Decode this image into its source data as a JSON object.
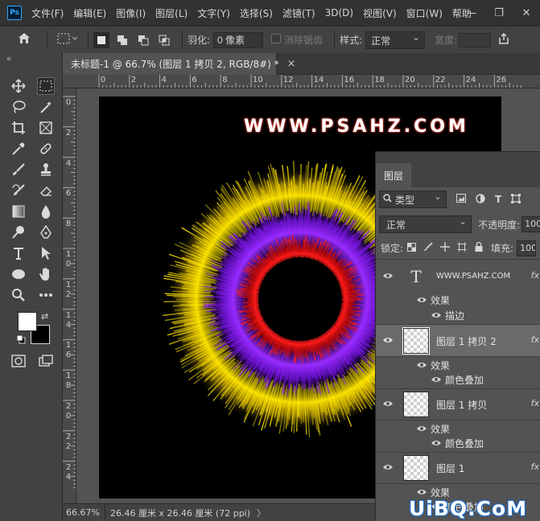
{
  "app": {
    "logo": "Ps"
  },
  "menu": [
    "文件(F)",
    "编辑(E)",
    "图像(I)",
    "图层(L)",
    "文字(Y)",
    "选择(S)",
    "滤镜(T)",
    "3D(D)",
    "视图(V)",
    "窗口(W)",
    "帮助"
  ],
  "window_controls": {
    "minimize": "—",
    "restore": "❐",
    "close": "✕"
  },
  "options_bar": {
    "feather_label": "羽化:",
    "feather_value": "0 像素",
    "antialias_label": "消除锯齿",
    "style_label": "样式:",
    "style_value": "正常",
    "width_label": "宽度:"
  },
  "toolbar": {
    "collapse": "«"
  },
  "document": {
    "tab_title": "未标题-1 @ 66.7% (图层 1 拷贝 2, RGB/8#) *",
    "close": "×",
    "watermark_text": "WWW.PSAHZ.COM"
  },
  "ruler": {
    "top_labels": [
      "0",
      "2",
      "4",
      "6",
      "8",
      "10",
      "12",
      "14",
      "16",
      "18",
      "20",
      "22",
      "24",
      "26"
    ],
    "left_labels": [
      "0",
      "2",
      "4",
      "6",
      "8",
      "10",
      "12",
      "14",
      "16",
      "18",
      "20",
      "22",
      "24"
    ]
  },
  "status_bar": {
    "zoom": "66.67%",
    "doc_info": "26.46 厘米 x 26.46 厘米 (72 ppi)",
    "arrow": "〉"
  },
  "layers_panel": {
    "tab_label": "图层",
    "filter_label": "类型",
    "blend_mode": "正常",
    "opacity_label": "不透明度:",
    "opacity_value": "100",
    "lock_label": "锁定:",
    "fill_label": "填充:",
    "fill_value": "100",
    "layers": [
      {
        "name": "WWW.PSAHZ.COM",
        "kind": "text",
        "selected": false,
        "effects_label": "效果",
        "effects": [
          "描边"
        ]
      },
      {
        "name": "图层 1 拷贝 2",
        "kind": "pixel",
        "selected": true,
        "effects_label": "效果",
        "effects": [
          "颜色叠加"
        ]
      },
      {
        "name": "图层 1 拷贝",
        "kind": "pixel",
        "selected": false,
        "effects_label": "效果",
        "effects": [
          "颜色叠加"
        ]
      },
      {
        "name": "图层 1",
        "kind": "pixel",
        "selected": false,
        "effects_label": "效果",
        "effects": [
          "颜色叠加"
        ]
      }
    ],
    "fx_mark": "fx"
  },
  "site_watermark": "UiBQ.CoM",
  "colors": {
    "ring_outer": "#ffe600",
    "ring_middle": "#8a1cff",
    "ring_inner": "#ff1a1a",
    "accent": "#31a8ff"
  }
}
